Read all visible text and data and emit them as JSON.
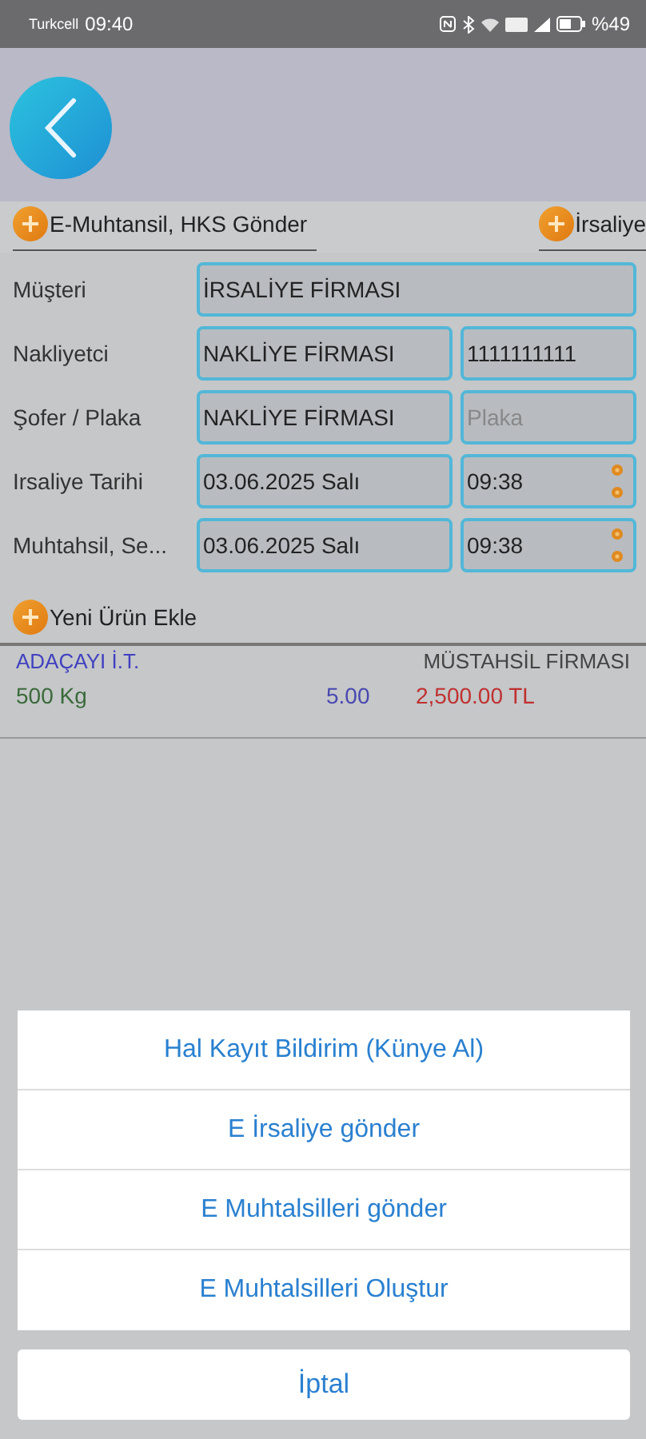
{
  "status_bar": {
    "carrier": "Turkcell",
    "time": "09:40",
    "battery": "%49"
  },
  "toolbar": [
    {
      "label": "E-Muhtansil, HKS Gönder"
    },
    {
      "label": "İrsaliye"
    }
  ],
  "form": [
    {
      "label": "Müşteri",
      "fields": [
        {
          "kind": "text",
          "value": "İRSALİYE FİRMASI"
        }
      ]
    },
    {
      "label": "Nakliyetci",
      "fields": [
        {
          "kind": "text",
          "value": "NAKLİYE FİRMASI"
        },
        {
          "kind": "text",
          "value": "1111111111"
        }
      ]
    },
    {
      "label": "Şofer / Plaka",
      "fields": [
        {
          "kind": "text",
          "value": "NAKLİYE FİRMASI"
        },
        {
          "kind": "text",
          "placeholder": "Plaka"
        }
      ]
    },
    {
      "label": "Irsaliye Tarihi",
      "fields": [
        {
          "kind": "text",
          "value": "03.06.2025 Salı"
        },
        {
          "kind": "time",
          "value": "09:38"
        }
      ]
    },
    {
      "label": "Muhtahsil, Se...",
      "fields": [
        {
          "kind": "text",
          "value": "03.06.2025 Salı"
        },
        {
          "kind": "time",
          "value": "09:38"
        }
      ]
    }
  ],
  "add_product": "Yeni Ürün Ekle",
  "products": [
    {
      "name": "ADAÇAYI İ.T.",
      "supplier": "MÜSTAHSİL FİRMASI",
      "quantity": "500 Kg",
      "price": "5.00",
      "total": "2,500.00 TL"
    }
  ],
  "action_sheet": {
    "actions": [
      "Hal Kayıt Bildirim (Künye Al)",
      "E İrsaliye gönder",
      "E Muhtalsilleri gönder",
      "E Muhtalsilleri Oluştur"
    ],
    "cancel": "İptal"
  }
}
